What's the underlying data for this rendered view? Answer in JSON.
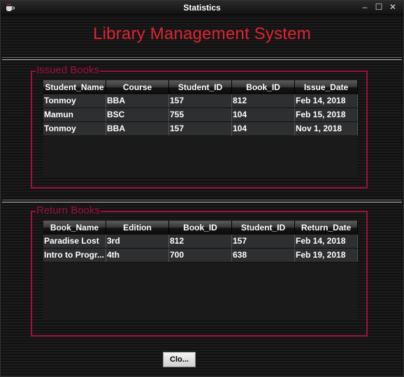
{
  "window": {
    "title": "Statistics",
    "controls": {
      "minimize": "–",
      "maximize": "☐",
      "close": "✕"
    }
  },
  "heading": "Library Management System",
  "issued_books": {
    "title": "Issued Books",
    "columns": [
      "Student_Name",
      "Course",
      "Student_ID",
      "Book_ID",
      "Issue_Date"
    ],
    "rows": [
      [
        "Tonmoy",
        "BBA",
        "157",
        "812",
        "Feb 14, 2018"
      ],
      [
        "Mamun",
        "BSC",
        "755",
        "104",
        "Feb 15, 2018"
      ],
      [
        "Tonmoy",
        "BBA",
        "157",
        "104",
        "Nov 1, 2018"
      ]
    ]
  },
  "return_books": {
    "title": "Return Books",
    "columns": [
      "Book_Name",
      "Edition",
      "Book_ID",
      "Student_ID",
      "Return_Date"
    ],
    "rows": [
      [
        "Paradise Lost",
        "3rd",
        "812",
        "157",
        "Feb 14, 2018"
      ],
      [
        "Intro to Progr...",
        "4th",
        "700",
        "638",
        "Feb 19, 2018"
      ]
    ]
  },
  "close_button": {
    "label": "Clo..."
  },
  "colors": {
    "accent_red": "#e0242f",
    "panel_border": "#a0103a"
  }
}
